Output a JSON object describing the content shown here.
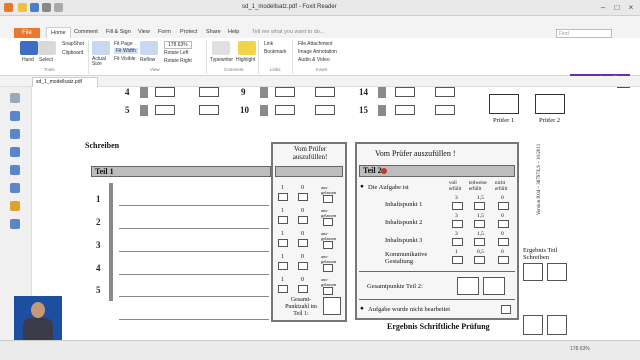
{
  "window": {
    "title": "sd_1_modellsatz.pdf - Foxit Reader"
  },
  "ribbon_tabs": [
    "File",
    "Home",
    "Comment",
    "Fill & Sign",
    "View",
    "Form",
    "Protect",
    "Share",
    "Help"
  ],
  "active_tab": "Home",
  "tell_me": "Tell me what you want to do...",
  "find_placeholder": "Find",
  "ribbon": {
    "hand": "Hand",
    "select": "Select",
    "snapshot": "SnapShot",
    "clipboard": "Clipboard",
    "actual_size": "Actual Size",
    "fit_page": "Fit Page",
    "fit_width": "Fit Width",
    "fit_visible": "Fit Visible",
    "reflow": "Reflow",
    "zoom": "178.63%",
    "rotate_left": "Rotate Left",
    "rotate_right": "Rotate Right",
    "typewriter": "Typewriter",
    "highlight": "Highlight",
    "link": "Link",
    "bookmark": "Bookmark",
    "file_attachment": "File Attachment",
    "image_annotation": "Image Annotation",
    "audio_video": "Audio & Video",
    "group_tools": "Tools",
    "group_view": "View",
    "group_comment": "Comment",
    "group_links": "Links",
    "group_insert": "Insert"
  },
  "promo": "Convert your image files to PDF",
  "doc_tab": "sd_1_modellsatz.pdf",
  "document": {
    "nums_top_left": [
      "4",
      "5"
    ],
    "nums_top_mid": [
      "9",
      "10"
    ],
    "nums_top_right": [
      "14",
      "15"
    ],
    "pruefer1": "Prüfer 1",
    "pruefer2": "Prüfer 2",
    "schreiben": "Schreiben",
    "vom_pruefer_small": "Vom Prüfer auszufüllen!",
    "teil1": "Teil 1",
    "teil1_nums": [
      "1",
      "2",
      "3",
      "4",
      "5"
    ],
    "mid_scores": [
      [
        "1",
        "0",
        "aus-gelassen"
      ],
      [
        "1",
        "0",
        "aus-gelassen"
      ],
      [
        "1",
        "0",
        "aus-gelassen"
      ],
      [
        "1",
        "0",
        "aus-gelassen"
      ],
      [
        "1",
        "0",
        "aus-gelassen"
      ]
    ],
    "gesamt": "Gesamt-Punktzahl im Teil 1:",
    "vom_pruefer_big": "Vom Prüfer auszufüllen !",
    "teil2": "Teil 2",
    "aufgabe_ist": "Die Aufgabe ist",
    "col_voll": "voll erfüllt",
    "col_teil": "teilweise erfüllt",
    "col_nicht": "nicht erfüllt",
    "rows": [
      {
        "label": "Inhaltspunkt 1",
        "vals": [
          "3",
          "1,5",
          "0"
        ]
      },
      {
        "label": "Inhaltspunkt 2",
        "vals": [
          "3",
          "1,5",
          "0"
        ]
      },
      {
        "label": "Inhaltspunkt 3",
        "vals": [
          "3",
          "1,5",
          "0"
        ]
      },
      {
        "label": "Kommunikative Gestaltung",
        "vals": [
          "1",
          "0,5",
          "0"
        ]
      }
    ],
    "gesamt2": "Gesamtpunkte Teil 2:",
    "nicht_bearbeitet": "Aufgabe wurde nicht bearbeitet",
    "ergebnis_teil": "Ergebnis Teil Schreiben",
    "ergebnis_final": "Ergebnis Schriftliche Prüfung",
    "version": "Version 8.04 – 36797/LS – 10/2011"
  },
  "status": {
    "zoom": "178.63%"
  }
}
